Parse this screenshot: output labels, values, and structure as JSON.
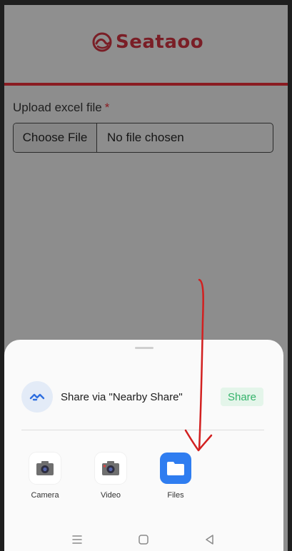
{
  "header": {
    "brand": "Seataoo",
    "brand_color": "#7a1e26",
    "accent_line_color": "#8a1c22"
  },
  "form": {
    "upload_label": "Upload excel file",
    "required_mark": "*",
    "choose_button": "Choose File",
    "file_status": "No file chosen"
  },
  "share_sheet": {
    "nearby": {
      "icon": "nearby-share-icon",
      "text": "Share via \"Nearby Share\"",
      "button": "Share",
      "button_color": "#34b36a"
    },
    "apps": [
      {
        "label": "Camera",
        "icon": "camera-icon"
      },
      {
        "label": "Video",
        "icon": "video-camera-icon"
      },
      {
        "label": "Files",
        "icon": "folder-icon"
      }
    ]
  },
  "nav": {
    "items": [
      "menu-icon",
      "home-icon",
      "back-icon"
    ]
  },
  "annotation": {
    "color": "#d22020",
    "icon": "arrow-down-annotation"
  }
}
